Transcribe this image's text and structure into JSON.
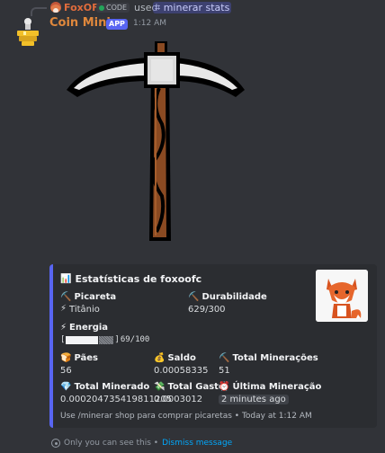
{
  "reply": {
    "username": "FoxOFC",
    "tag_label": "CODE",
    "used_text": "used",
    "command": "minerar stats"
  },
  "message": {
    "bot_name": "Coin Mining",
    "app_badge": "APP",
    "timestamp": "1:12 AM"
  },
  "embed": {
    "accent_color": "#5865f2",
    "title": "Estatísticas de foxoofc",
    "title_icon": "bar-chart-icon",
    "fields": {
      "picareta": {
        "name": "Picareta",
        "value": "Titânio",
        "name_icon": "pickaxe-icon",
        "value_icon": "lightning-icon"
      },
      "durabilidade": {
        "name": "Durabilidade",
        "value": "629/300",
        "name_icon": "pickaxe-icon"
      },
      "energia": {
        "name": "Energia",
        "bar_open": "[",
        "bar_close": "]",
        "value": "69/100",
        "fill_fraction": 0.69,
        "name_icon": "lightning-icon"
      },
      "paes": {
        "name": "Pães",
        "value": "56",
        "name_icon": "bread-icon"
      },
      "saldo": {
        "name": "Saldo",
        "value": "0.00058335",
        "name_icon": "money-bag-icon"
      },
      "total_mineracoes": {
        "name": "Total Minerações",
        "value": "51",
        "name_icon": "pickaxe-icon"
      },
      "total_minerado": {
        "name": "Total Minerado",
        "value": "0.0002047354198112​05",
        "name_icon": "diamond-icon"
      },
      "total_gasto": {
        "name": "Total Gasto",
        "value": "0.0003012",
        "name_icon": "money-with-wings-icon"
      },
      "ultima_mineracao": {
        "name": "Última Mineração",
        "value": "2 minutes ago",
        "name_icon": "alarm-clock-icon"
      }
    },
    "footer": "Use /minerar shop para comprar picaretas • Today at 1:12 AM"
  },
  "ephemeral": {
    "text": "Only you can see this •",
    "dismiss": "Dismiss message"
  }
}
